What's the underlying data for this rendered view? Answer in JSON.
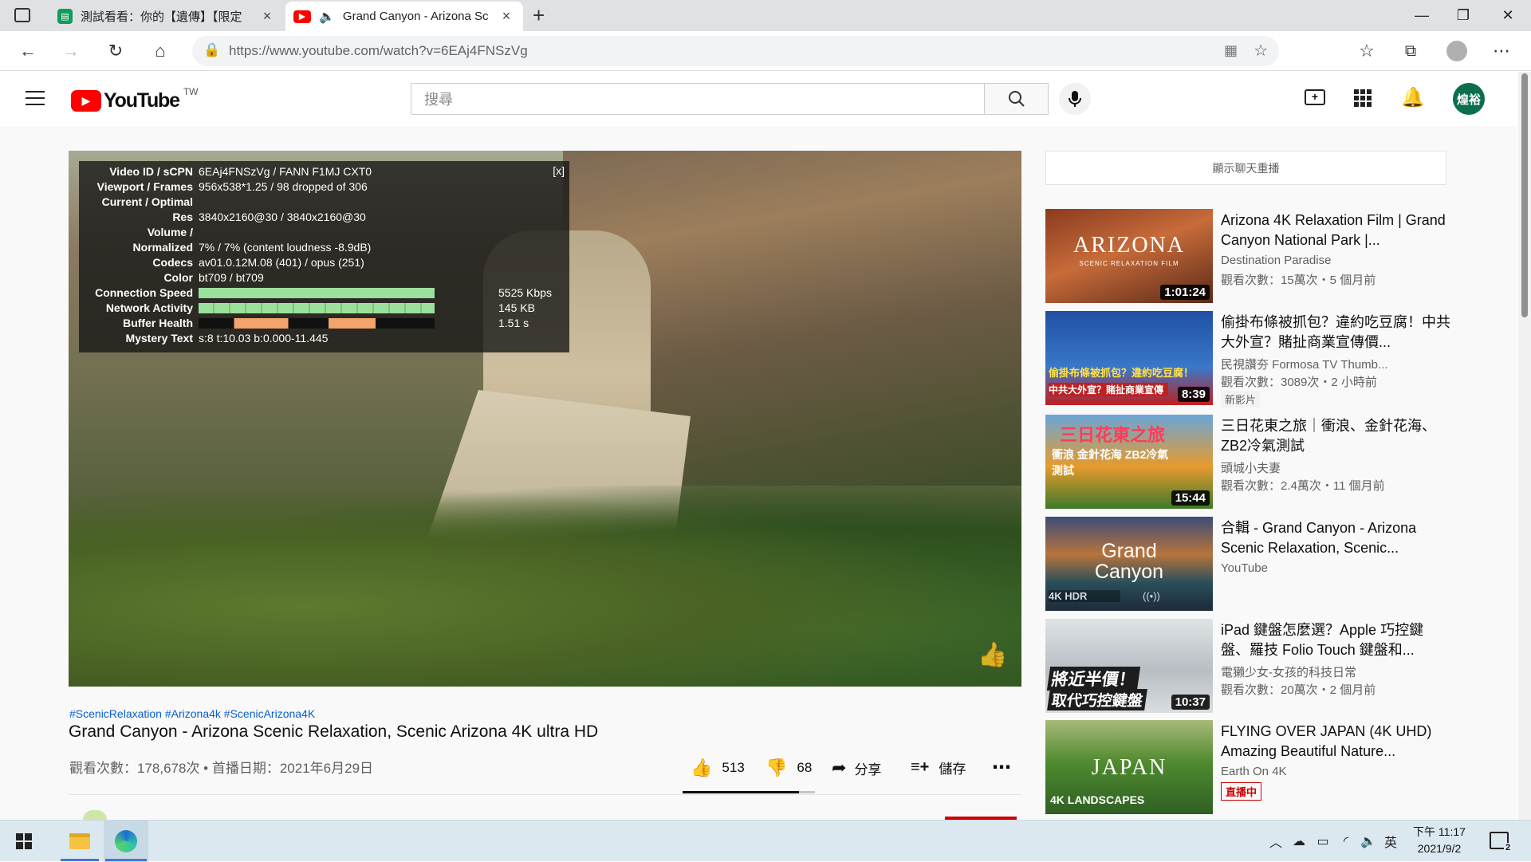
{
  "browser": {
    "tabs": [
      {
        "title": "測試看看：你的【遺傳】【限定",
        "icon": "sheet-icon"
      },
      {
        "title": "Grand Canyon - Arizona Sc",
        "icon": "youtube-icon",
        "audio": true
      }
    ],
    "url": "https://www.youtube.com/watch?v=6EAj4FNSzVg"
  },
  "youtube": {
    "logo_text": "YouTube",
    "region": "TW",
    "search_placeholder": "搜尋",
    "avatar_text": "煌裕"
  },
  "stats": {
    "close_label": "[x]",
    "rows": [
      {
        "label": "Video ID / sCPN",
        "value": "6EAj4FNSzVg / FANN F1MJ CXT0"
      },
      {
        "label": "Viewport / Frames",
        "value": "956x538*1.25 / 98 dropped of 306"
      },
      {
        "label": "Current / Optimal",
        "value": ""
      },
      {
        "label": "Res",
        "value": "3840x2160@30 / 3840x2160@30"
      },
      {
        "label": "Volume /",
        "value": ""
      },
      {
        "label": "Normalized",
        "value": "7% / 7% (content loudness -8.9dB)"
      },
      {
        "label": "Codecs",
        "value": "av01.0.12M.08 (401) / opus (251)"
      },
      {
        "label": "Color",
        "value": "bt709 / bt709"
      },
      {
        "label": "Connection Speed",
        "value": "5525 Kbps"
      },
      {
        "label": "Network Activity",
        "value": "145 KB"
      },
      {
        "label": "Buffer Health",
        "value": "1.51 s"
      },
      {
        "label": "Mystery Text",
        "value": "s:8 t:10.03 b:0.000-11.445"
      }
    ]
  },
  "video": {
    "hashtags": "#ScenicRelaxation #Arizona4k #ScenicArizona4K",
    "title": "Grand Canyon - Arizona Scenic Relaxation, Scenic Arizona 4K ultra HD",
    "meta": "觀看次數：178,678次 • 首播日期：2021年6月29日",
    "likes": "513",
    "dislikes": "68",
    "share_label": "分享",
    "save_label": "儲存"
  },
  "sidebar": {
    "chat_replay_label": "顯示聊天重播",
    "recommendations": [
      {
        "title": "Arizona 4K Relaxation Film | Grand Canyon National Park |...",
        "channel": "Destination Paradise",
        "stats": "觀看次數：15萬次・5 個月前",
        "duration": "1:01:24",
        "thumb_text": "ARIZONA",
        "thumb_sub": "SCENIC RELAXATION FILM"
      },
      {
        "title": "偷掛布條被抓包？違約吃豆腐！中共大外宣？賭扯商業宣傳價...",
        "channel": "民視讚夯 Formosa TV Thumb...",
        "stats": "觀看次數：3089次・2 小時前",
        "duration": "8:39",
        "badge": "新影片",
        "thumb_text": "偷掛布條被抓包？違約吃豆腐！",
        "thumb_sub": "中共大外宣？賭扯商業宣傳"
      },
      {
        "title": "三日花東之旅｜衝浪、金針花海、ZB2冷氣測試",
        "channel": "頭城小夫妻",
        "stats": "觀看次數：2.4萬次・11 個月前",
        "duration": "15:44",
        "thumb_text": "三日花東之旅",
        "thumb_sub": "衝浪 金針花海 ZB2冷氣測試"
      },
      {
        "title": "合輯 - Grand Canyon - Arizona Scenic Relaxation, Scenic...",
        "channel": "YouTube",
        "stats": "",
        "thumb_text": "Grand Canyon",
        "thumb_sub": "4K HDR"
      },
      {
        "title": "iPad 鍵盤怎麼選？Apple 巧控鍵盤、羅技 Folio Touch 鍵盤和...",
        "channel": "電獺少女-女孩的科技日常",
        "stats": "觀看次數：20萬次・2 個月前",
        "duration": "10:37",
        "thumb_text": "將近半價！",
        "thumb_sub": "取代巧控鍵盤"
      },
      {
        "title": "FLYING OVER JAPAN (4K UHD) Amazing Beautiful Nature...",
        "channel": "Earth On 4K",
        "stats": "",
        "badge": "直播中",
        "thumb_text": "JAPAN",
        "thumb_sub": "4K LANDSCAPES"
      }
    ]
  },
  "taskbar": {
    "ime": "英",
    "time": "下午 11:17",
    "date": "2021/9/2",
    "notification_count": "2"
  },
  "colors": {
    "youtube_red": "#ff0000",
    "link_blue": "#065fd4",
    "stats_bar_green": "#9be09b",
    "buffer_orange": "#f2a46a"
  }
}
